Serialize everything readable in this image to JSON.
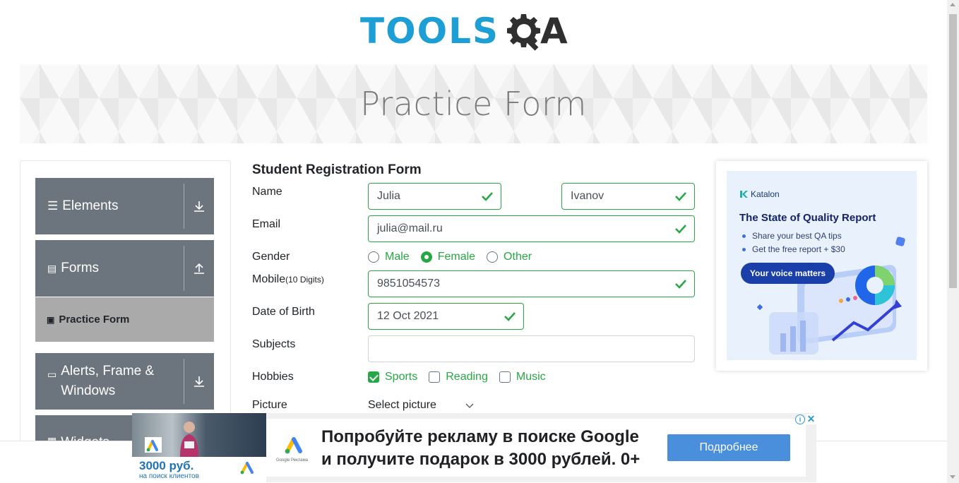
{
  "header": {
    "logo_text": "TOOLSQA",
    "logo_primary": "TOOLS",
    "logo_secondary": "A"
  },
  "banner": {
    "title": "Practice Form"
  },
  "sidebar": {
    "groups": [
      {
        "label": "Elements",
        "icon": "hamburger-icon",
        "arrow": "download-arrow-icon"
      },
      {
        "label": "Forms",
        "icon": "document-icon",
        "arrow": "upload-arrow-icon"
      },
      {
        "label": "Alerts, Frame & Windows",
        "icon": "window-icon",
        "arrow": "download-arrow-icon"
      },
      {
        "label": "Widgets",
        "icon": "widget-icon"
      }
    ],
    "active_item": {
      "label": "Practice Form",
      "icon": "page-icon"
    }
  },
  "form": {
    "heading": "Student Registration Form",
    "name_label": "Name",
    "first_name": "Julia",
    "last_name": "Ivanov",
    "email_label": "Email",
    "email": "julia@mail.ru",
    "gender_label": "Gender",
    "gender_options": [
      "Male",
      "Female",
      "Other"
    ],
    "gender_selected": "Female",
    "mobile_label": "Mobile",
    "mobile_hint": "(10 Digits)",
    "mobile": "9851054573",
    "dob_label": "Date of Birth",
    "dob": "12 Oct 2021",
    "subjects_label": "Subjects",
    "subjects": "",
    "hobbies_label": "Hobbies",
    "hobby_options": [
      "Sports",
      "Reading",
      "Music"
    ],
    "hobbies_checked": [
      "Sports"
    ],
    "picture_label": "Picture",
    "picture_select": "Select picture"
  },
  "side_ad": {
    "brand": "Katalon",
    "title": "The State of Quality Report",
    "bullets": [
      "Share your best QA tips",
      "Get the free report + $30"
    ],
    "button": "Your voice matters"
  },
  "bottom_ad": {
    "line1": "Попробуйте рекламу в поиске Google",
    "line2": "и получите подарок в 3000 рублей. 0+",
    "button": "Подробнее",
    "price": "3000 руб.",
    "price_sub": "на поиск клиентов",
    "logo_caption": "Google Реклама",
    "info": "i",
    "close": "✕"
  },
  "colors": {
    "valid": "#28a745",
    "sidebar_group": "#6c757d",
    "sidebar_active": "#aaaaaa",
    "logo_blue": "#1d9fd6",
    "ad_button": "#4a8fdc"
  }
}
